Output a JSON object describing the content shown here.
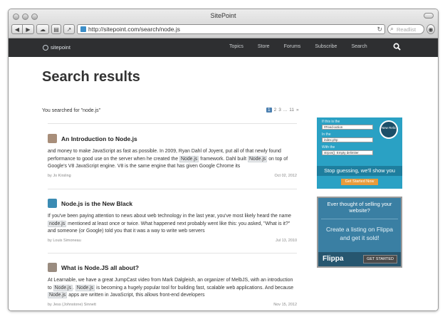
{
  "window": {
    "title": "SitePoint"
  },
  "browser": {
    "url": "http://sitepoint.com/search/node.js",
    "search_placeholder": "Readlist"
  },
  "nav": {
    "logo_text": "sitepoint",
    "items": [
      "Topics",
      "Store",
      "Forums",
      "Subscribe",
      "Search"
    ]
  },
  "page": {
    "title": "Search results",
    "searched": "You searched for \"node.js\""
  },
  "pagination": {
    "pages": [
      "1",
      "2",
      "3",
      "...",
      "11",
      "»"
    ],
    "current": "1"
  },
  "results": [
    {
      "title": "An Introduction to Node.js",
      "desc_parts": [
        "and money to make JavaScript as fast as possible. In 2009, Ryan Dahl of Joyent, put all of that newly found performance to good use on the server when he created the ",
        "Node.js",
        " framework. Dahl built ",
        "Node.js",
        " on top of Google's V8 JavaScript engine. V8 is the same engine that has given Google Chrome its"
      ],
      "author": "by Jo Kirsling",
      "date": "Oct 02, 2012"
    },
    {
      "title": "Node.js is the New Black",
      "desc_parts": [
        "If you've been paying attention to news about web technology in the last year, you've most likely heard the name ",
        "node.js",
        " mentioned at least once or twice. What happened next probably went like this: you asked, \"What is it?\" and someone (or Google) told you that it was a way to write web servers"
      ],
      "author": "by Louis Simoneau",
      "date": "Jul 13, 2010"
    },
    {
      "title": "What is Node.JS all about?",
      "desc_parts": [
        "At Learnable, we have a great JumpCast video from Mark Dalgleish, an organizer of MelbJS, with an introduction to ",
        "Node.js",
        ". ",
        "Node.js",
        " is becoming a hugely popular tool for building fast, scalable web applications. And because ",
        "Node.js",
        " apps are written in JavaScript, this allows front-end developers"
      ],
      "author": "by Jess (Johnstone) Sinnett",
      "date": "Nov 15, 2012"
    }
  ],
  "ads": {
    "ad1": {
      "labels": [
        "If this is the",
        "In the",
        "With the"
      ],
      "selects": [
        "#Feed-action",
        "index.php",
        "strpos(): Empty delimiter"
      ],
      "badge": "New Relic",
      "tagline": "Stop guessing, we'll show you",
      "cta": "Get Started Now"
    },
    "ad2": {
      "headline": "Ever thought of selling your website?",
      "body": "Create a listing on Flippa and get it sold!",
      "brand": "Flippa",
      "cta": "GET STARTED"
    }
  },
  "colors": {
    "nav_bg": "#2e2f31",
    "ad1_bg": "#2aa1c4",
    "ad2_bg": "#3a7fa3",
    "accent": "#4a7fb0"
  }
}
